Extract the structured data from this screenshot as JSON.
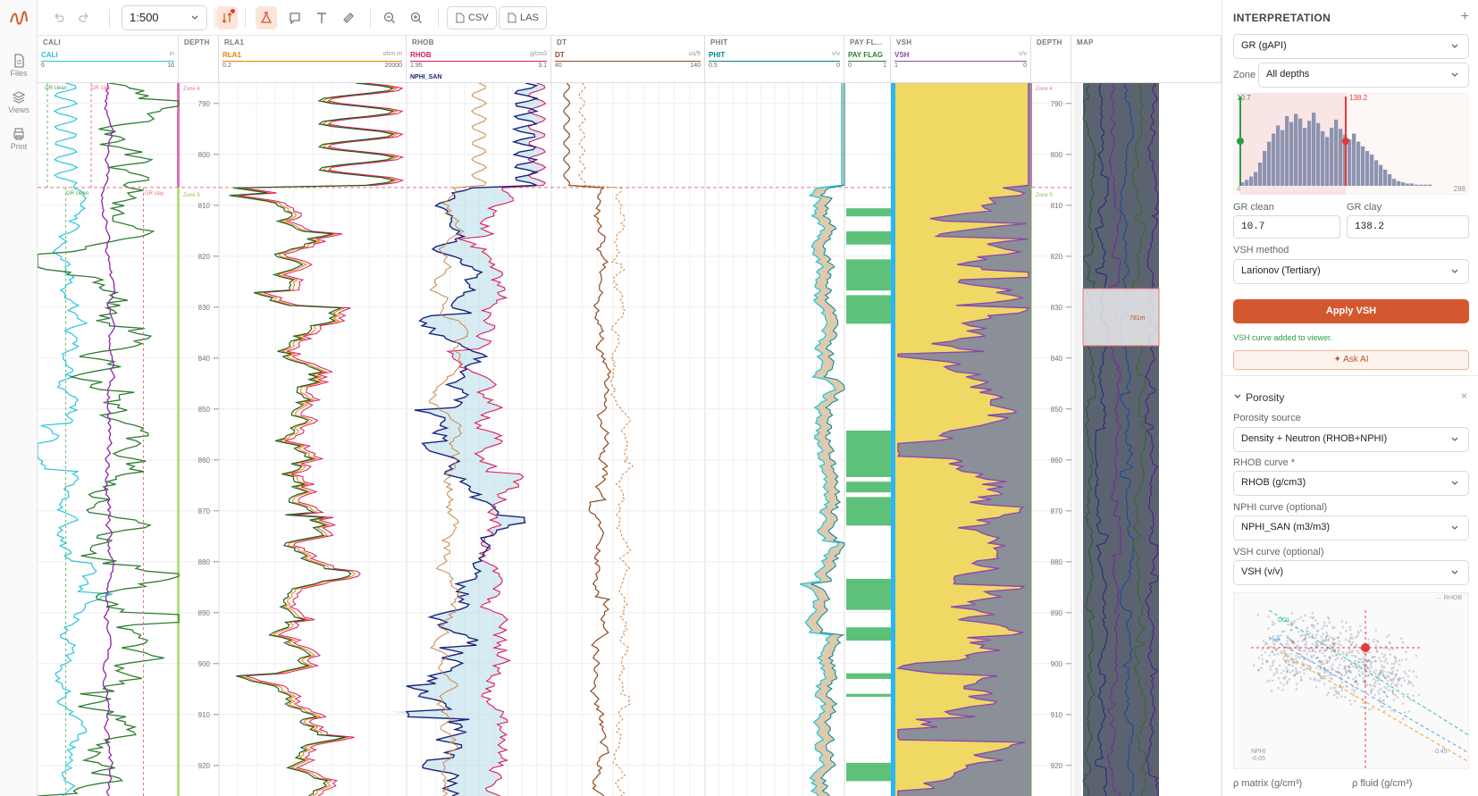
{
  "rail": [
    {
      "label": "Files",
      "icon": "file-icon"
    },
    {
      "label": "Views",
      "icon": "layers-icon"
    },
    {
      "label": "Print",
      "icon": "printer-icon"
    }
  ],
  "toolbar": {
    "scale": "1:500",
    "csv": "CSV",
    "las": "LAS"
  },
  "tracks": [
    {
      "title": "CALI",
      "curve": "CALI",
      "unit": "in",
      "lo": "6",
      "hi": "16",
      "color": "#26c6da"
    },
    {
      "title": "DEPTH"
    },
    {
      "title": "RLA1",
      "curve": "RLA1",
      "unit": "ohm.m",
      "lo": "0.2",
      "hi": "20000",
      "color": "#f57c00"
    },
    {
      "title": "RHOB",
      "curve": "RHOB",
      "unit": "g/cm3",
      "lo": "1.95",
      "hi": "3.1",
      "color": "#d81b60",
      "curve2": "NPHI_SAN",
      "color2": "#1a237e"
    },
    {
      "title": "DT",
      "curve": "DT",
      "unit": "us/ft",
      "lo": "40",
      "hi": "140",
      "color": "#8d4b1c"
    },
    {
      "title": "PHIT",
      "curve": "PHIT",
      "unit": "v/v",
      "lo": "0.5",
      "hi": "0",
      "color": "#00838f"
    },
    {
      "title": "PAY FL...",
      "curve": "PAY FLAG",
      "unit": "",
      "lo": "0",
      "hi": "1",
      "color": "#2e7d32"
    },
    {
      "title": "VSH",
      "curve": "VSH",
      "unit": "v/v",
      "lo": "1",
      "hi": "0",
      "color": "#8e44ad"
    },
    {
      "title": "DEPTH"
    },
    {
      "title": "MAP"
    }
  ],
  "depth": {
    "start": 786,
    "end": 926,
    "ticks": [
      "790",
      "800",
      "810",
      "820",
      "830",
      "840",
      "850",
      "860",
      "870",
      "880",
      "890",
      "900",
      "910",
      "920"
    ]
  },
  "zones": {
    "top": "Zone 4",
    "bottom": "Zone 5",
    "boundary": 806.5
  },
  "cali_labels": {
    "gr_clean": "GR clean",
    "gr_clay": "GR clay"
  },
  "map_label": "781m",
  "interp": {
    "title": "INTERPRETATION",
    "curve_select": "GR (gAPI)",
    "zone_label": "Zone",
    "zone": "All depths",
    "hist": {
      "min": "4",
      "max": "288",
      "clean": "10.7",
      "clay": "138.2",
      "bins": [
        3,
        5,
        8,
        12,
        20,
        30,
        38,
        45,
        52,
        48,
        60,
        55,
        62,
        58,
        50,
        56,
        63,
        54,
        47,
        42,
        50,
        57,
        49,
        44,
        40,
        45,
        38,
        34,
        30,
        27,
        22,
        18,
        14,
        10,
        6,
        4,
        3,
        2,
        2,
        1,
        1,
        1,
        1,
        0,
        0,
        0,
        0,
        0
      ]
    },
    "gr_clean_label": "GR clean",
    "gr_clean": "10.7",
    "gr_clay_label": "GR clay",
    "gr_clay": "138.2",
    "method_label": "VSH method",
    "method": "Larionov (Tertiary)",
    "apply": "Apply VSH",
    "status": "VSH curve added to viewer.",
    "ask": "✦ Ask AI",
    "porosity": "Porosity",
    "source_label": "Porosity source",
    "source": "Density + Neutron (RHOB+NPHI)",
    "rhob_label": "RHOB curve *",
    "rhob": "RHOB (g/cm3)",
    "nphi_label": "NPHI curve (optional)",
    "nphi": "NPHI_SAN (m3/m3)",
    "vsh_label": "VSH curve (optional)",
    "vsh": "VSH (v/v)",
    "xplot": {
      "y": "← RHOB",
      "x": "NPHI",
      "xmin": "-0.05",
      "xmax": "0.45",
      "dol": "DOL",
      "ls": "LS"
    },
    "matrix_label": "ρ matrix (g/cm³)",
    "fluid_label": "ρ fluid (g/cm³)"
  },
  "colors": {
    "accent": "#d4582f",
    "status": "#2e9b45"
  }
}
